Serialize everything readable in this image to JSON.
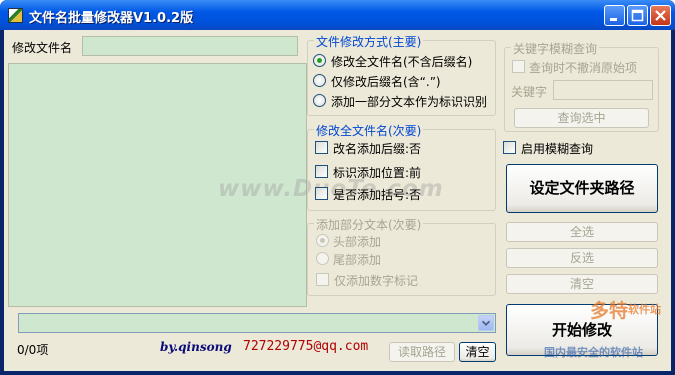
{
  "window": {
    "title": "文件名批量修改器V1.0.2版"
  },
  "left": {
    "rename_label": "修改文件名",
    "rename_value": "",
    "count_text": "0/0项"
  },
  "group_mode": {
    "title": "文件修改方式(主要)",
    "options": [
      "修改全文件名(不含后缀名)",
      "仅修改后缀名(含“.”)",
      "添加一部分文本作为标识识别"
    ]
  },
  "group_full": {
    "title": "修改全文件名(次要)",
    "options": [
      "改名添加后缀:否",
      "标识添加位置:前",
      "是否添加括号:否"
    ]
  },
  "group_partial": {
    "title": "添加部分文本(次要)",
    "options": [
      "头部添加",
      "尾部添加"
    ],
    "numeric_label": "仅添加数字标记"
  },
  "group_keyword": {
    "title": "关键字模糊查询",
    "keep_original_label": "查询时不撤消原始项",
    "keyword_label": "关键字",
    "query_button": "查询选中"
  },
  "fuzzy": {
    "label": "启用模糊查询"
  },
  "buttons": {
    "set_folder": "设定文件夹路径",
    "select_all": "全选",
    "invert": "反选",
    "clear_selection": "清空",
    "start": "开始修改",
    "read_path": "读取路径",
    "clear": "清空"
  },
  "footer": {
    "author": "by.qinsong",
    "email": "727229775@qq.com",
    "path_value": ""
  },
  "watermark": {
    "center": "www.DuoTe.com",
    "logo_big": "多特",
    "logo_small": "软件站",
    "logo_sub": "国内最安全的软件站"
  },
  "colors": {
    "title_bar": "#0058e6",
    "field_green": "#cfe6cf",
    "group_title_blue": "#0046d5",
    "author_blue": "#0a0a7a",
    "email_red": "#b00000"
  }
}
